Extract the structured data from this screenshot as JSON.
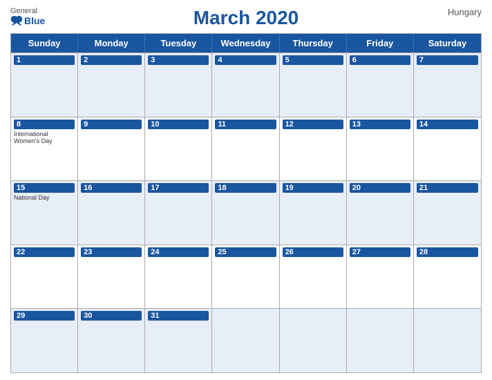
{
  "logo": {
    "general": "General",
    "blue": "Blue"
  },
  "country": "Hungary",
  "title": "March 2020",
  "header_days": [
    "Sunday",
    "Monday",
    "Tuesday",
    "Wednesday",
    "Thursday",
    "Friday",
    "Saturday"
  ],
  "weeks": [
    {
      "row_style": "row-even",
      "days": [
        {
          "date": "1",
          "events": []
        },
        {
          "date": "2",
          "events": []
        },
        {
          "date": "3",
          "events": []
        },
        {
          "date": "4",
          "events": []
        },
        {
          "date": "5",
          "events": []
        },
        {
          "date": "6",
          "events": []
        },
        {
          "date": "7",
          "events": []
        }
      ]
    },
    {
      "row_style": "row-odd",
      "days": [
        {
          "date": "8",
          "events": [
            "International Women's Day"
          ]
        },
        {
          "date": "9",
          "events": []
        },
        {
          "date": "10",
          "events": []
        },
        {
          "date": "11",
          "events": []
        },
        {
          "date": "12",
          "events": []
        },
        {
          "date": "13",
          "events": []
        },
        {
          "date": "14",
          "events": []
        }
      ]
    },
    {
      "row_style": "row-even",
      "days": [
        {
          "date": "15",
          "events": [
            "National Day"
          ]
        },
        {
          "date": "16",
          "events": []
        },
        {
          "date": "17",
          "events": []
        },
        {
          "date": "18",
          "events": []
        },
        {
          "date": "19",
          "events": []
        },
        {
          "date": "20",
          "events": []
        },
        {
          "date": "21",
          "events": []
        }
      ]
    },
    {
      "row_style": "row-odd",
      "days": [
        {
          "date": "22",
          "events": []
        },
        {
          "date": "23",
          "events": []
        },
        {
          "date": "24",
          "events": []
        },
        {
          "date": "25",
          "events": []
        },
        {
          "date": "26",
          "events": []
        },
        {
          "date": "27",
          "events": []
        },
        {
          "date": "28",
          "events": []
        }
      ]
    },
    {
      "row_style": "row-even",
      "days": [
        {
          "date": "29",
          "events": []
        },
        {
          "date": "30",
          "events": []
        },
        {
          "date": "31",
          "events": []
        },
        {
          "date": "",
          "events": []
        },
        {
          "date": "",
          "events": []
        },
        {
          "date": "",
          "events": []
        },
        {
          "date": "",
          "events": []
        }
      ]
    }
  ],
  "colors": {
    "header_bg": "#1a56a0",
    "header_text": "#ffffff",
    "accent": "#1a56a0",
    "row_even": "#e8eef8",
    "row_odd": "#ffffff"
  }
}
